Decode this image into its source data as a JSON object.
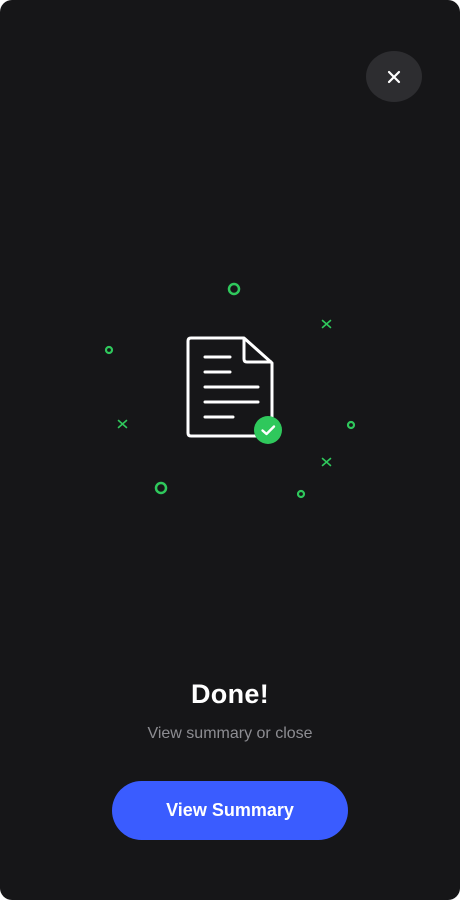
{
  "screen": {
    "background_color": "#161618"
  },
  "close_button": {
    "icon": "close-icon"
  },
  "illustration": {
    "icon": "document-check-icon",
    "accent_color": "#2fc85c",
    "decorations": [
      "circle",
      "circle",
      "circle",
      "circle",
      "circle",
      "cross",
      "cross",
      "cross"
    ]
  },
  "content": {
    "title": "Done!",
    "subtitle": "View summary or close"
  },
  "primary_button": {
    "label": "View Summary",
    "color": "#3a5cff"
  }
}
